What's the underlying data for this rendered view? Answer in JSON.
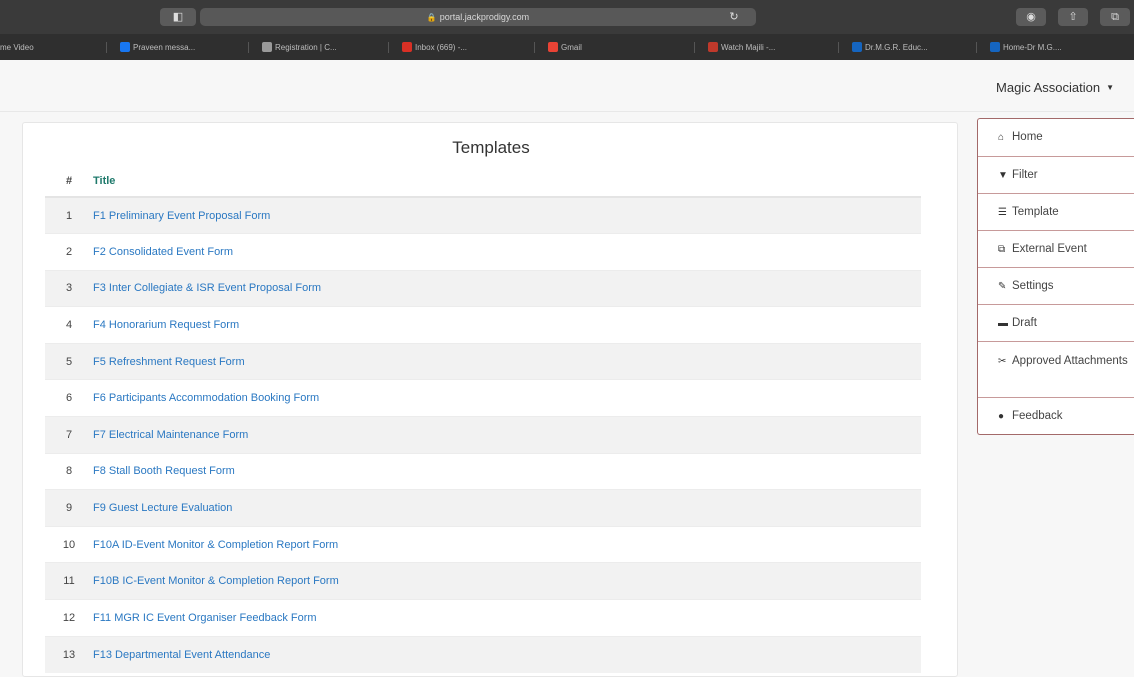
{
  "browser": {
    "url": "portal.jackprodigy.com",
    "bookmarks": [
      {
        "label": "me Video",
        "icon": "video-icon",
        "color": "#2f2f2f"
      },
      {
        "label": "Praveen messa...",
        "icon": "messenger-icon",
        "color": "#1877f2"
      },
      {
        "label": "Registration | C...",
        "icon": "page-icon",
        "color": "#9a9a9a"
      },
      {
        "label": "Inbox (669) -...",
        "icon": "gmail-icon",
        "color": "#d93025"
      },
      {
        "label": "Gmail",
        "icon": "google-icon",
        "color": "#ea4335"
      },
      {
        "label": "Watch Majili -...",
        "icon": "play-icon",
        "color": "#c0392b"
      },
      {
        "label": "Dr.M.G.R. Educ...",
        "icon": "university-icon",
        "color": "#1565c0"
      },
      {
        "label": "Home-Dr M.G....",
        "icon": "university-icon",
        "color": "#1565c0"
      }
    ]
  },
  "header": {
    "user_menu_label": "Magic Association"
  },
  "main": {
    "title": "Templates",
    "columns": [
      "#",
      "Title"
    ],
    "rows": [
      {
        "num": "1",
        "title": "F1 Preliminary Event Proposal Form"
      },
      {
        "num": "2",
        "title": "F2 Consolidated Event Form"
      },
      {
        "num": "3",
        "title": "F3 Inter Collegiate & ISR Event Proposal Form"
      },
      {
        "num": "4",
        "title": "F4 Honorarium Request Form"
      },
      {
        "num": "5",
        "title": "F5 Refreshment Request Form"
      },
      {
        "num": "6",
        "title": "F6 Participants Accommodation Booking Form"
      },
      {
        "num": "7",
        "title": "F7 Electrical Maintenance Form"
      },
      {
        "num": "8",
        "title": "F8 Stall Booth Request Form"
      },
      {
        "num": "9",
        "title": "F9 Guest Lecture Evaluation"
      },
      {
        "num": "10",
        "title": "F10A ID-Event Monitor & Completion Report Form"
      },
      {
        "num": "11",
        "title": "F10B IC-Event Monitor & Completion Report Form"
      },
      {
        "num": "12",
        "title": "F11 MGR IC Event Organiser Feedback Form"
      },
      {
        "num": "13",
        "title": "F13 Departmental Event Attendance"
      }
    ]
  },
  "sidenav": {
    "items": [
      {
        "label": "Home",
        "icon": "home-icon",
        "glyph": "⌂"
      },
      {
        "label": "Filter",
        "icon": "filter-icon",
        "glyph": "▼"
      },
      {
        "label": "Template",
        "icon": "list-icon",
        "glyph": "☰"
      },
      {
        "label": "External Event",
        "icon": "external-link-icon",
        "glyph": "⧉"
      },
      {
        "label": "Settings",
        "icon": "wrench-icon",
        "glyph": "✎"
      },
      {
        "label": "Draft",
        "icon": "folder-icon",
        "glyph": "▬"
      },
      {
        "label": "Approved Attachments",
        "icon": "paperclip-icon",
        "glyph": "✂"
      },
      {
        "label": "Feedback",
        "icon": "comment-icon",
        "glyph": "●"
      }
    ]
  },
  "colors": {
    "link": "#2a78c2",
    "header_text": "#1f7a6c",
    "nav_border": "#a36969"
  }
}
